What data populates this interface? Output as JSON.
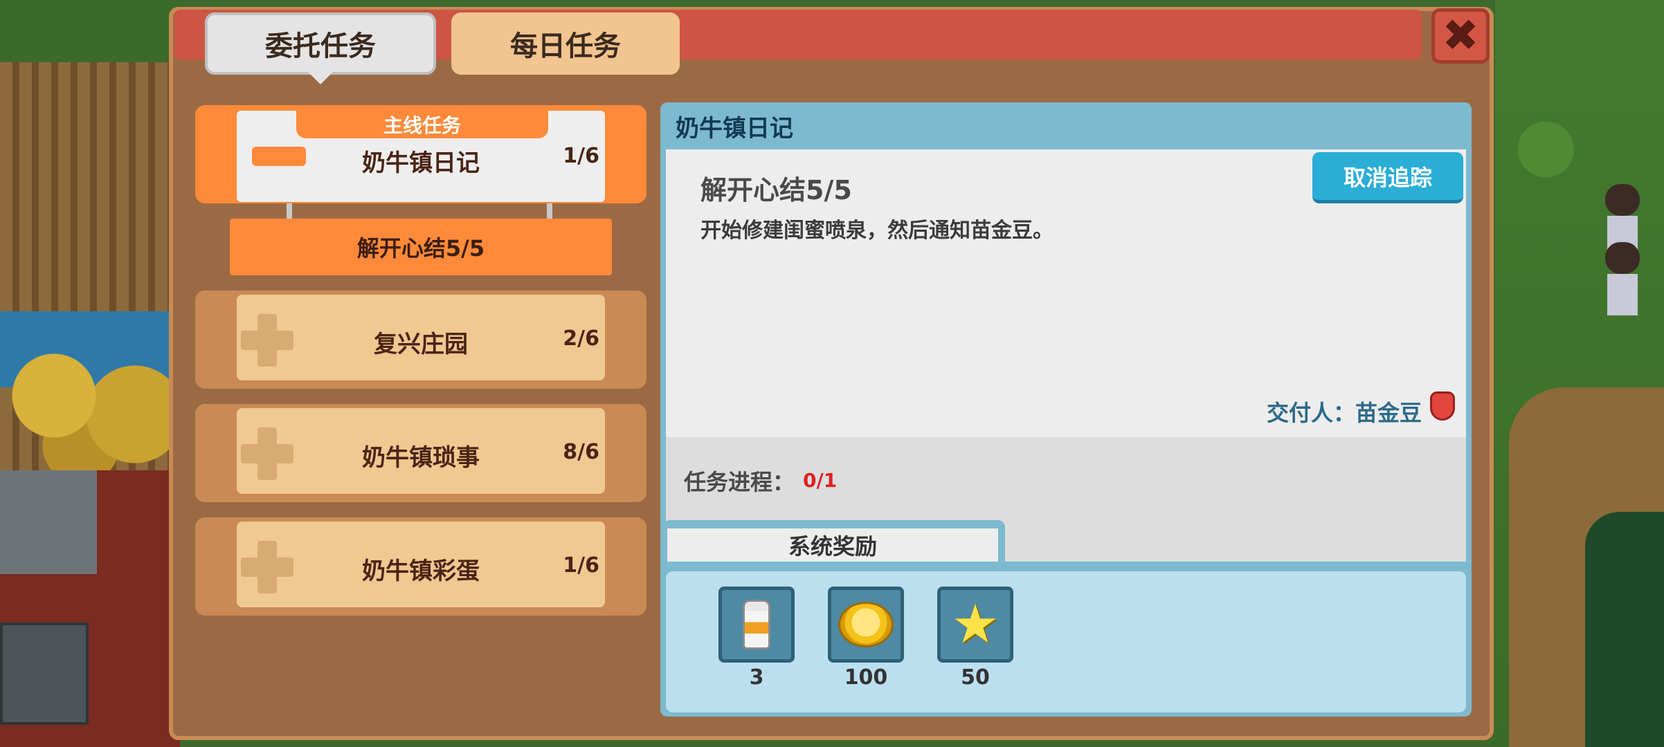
{
  "tabs": {
    "commission": "委托任务",
    "daily": "每日任务"
  },
  "close_icon": "✖",
  "quest_list": {
    "main_tag": "主线任务",
    "items": [
      {
        "name": "奶牛镇日记",
        "count": "1/6"
      },
      {
        "name": "复兴庄园",
        "count": "2/6"
      },
      {
        "name": "奶牛镇琐事",
        "count": "8/6"
      },
      {
        "name": "奶牛镇彩蛋",
        "count": "1/6"
      }
    ],
    "active_subtask": "解开心结5/5"
  },
  "detail": {
    "title": "奶牛镇日记",
    "task_title": "解开心结5/5",
    "task_desc": "开始修建闺蜜喷泉，然后通知苗金豆。",
    "untrack_label": "取消追踪",
    "giver": "交付人：苗金豆",
    "progress_label": "任务进程：",
    "progress_value": "0/1",
    "rewards_tab": "系统奖励",
    "rewards": [
      {
        "icon": "milk-bottle-icon",
        "qty": "3"
      },
      {
        "icon": "gold-coin-icon",
        "qty": "100"
      },
      {
        "icon": "star-icon",
        "qty": "50"
      }
    ]
  },
  "colors": {
    "header_red": "#cd5544",
    "active_orange": "#ff8a3a",
    "panel_brown": "#9b6a44",
    "detail_blue": "#7dbad0",
    "button_cyan": "#2aaed6",
    "progress_red": "#e02020"
  }
}
